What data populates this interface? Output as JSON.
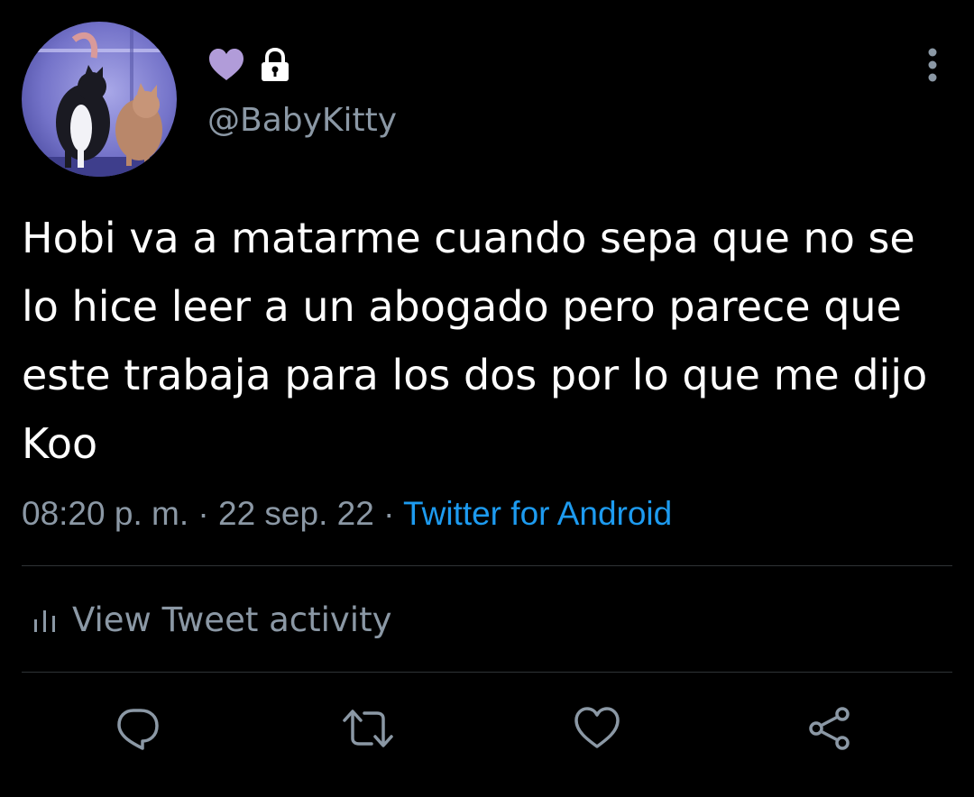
{
  "user": {
    "handle": "@BabyKitty",
    "name_icons": [
      "purple-heart-icon",
      "lock-icon"
    ]
  },
  "tweet": {
    "text": "Hobi va a matarme cuando sepa que no se lo hice leer a un abogado pero parece que este trabaja para los dos por lo que me dijo Koo",
    "time": "08:20 p. m.",
    "separator": "·",
    "date": "22 sep. 22",
    "source": "Twitter for Android"
  },
  "activity": {
    "label": "View Tweet activity",
    "icon": "bar-chart-icon"
  },
  "actions": [
    "reply-icon",
    "retweet-icon",
    "like-icon",
    "share-icon"
  ],
  "colors": {
    "background": "#000000",
    "text": "#ffffff",
    "secondary": "#8b98a5",
    "link": "#1d9bf0",
    "heart": "#b19cd9",
    "divider": "#2f3336"
  }
}
